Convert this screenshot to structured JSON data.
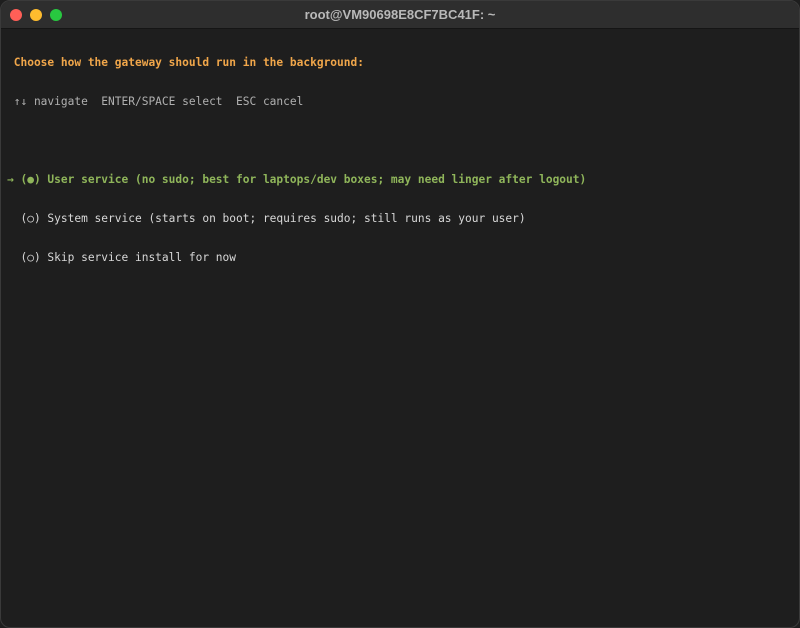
{
  "window": {
    "title": "root@VM90698E8CF7BC41F: ~",
    "controls": [
      "close",
      "minimize",
      "zoom"
    ]
  },
  "terminal": {
    "prompt": " Choose how the gateway should run in the background:",
    "hint": " ↑↓ navigate  ENTER/SPACE select  ESC cancel",
    "options": [
      {
        "text": "→ (●) User service (no sudo; best for laptops/dev boxes; may need linger after logout)",
        "selected": true
      },
      {
        "text": "  (○) System service (starts on boot; requires sudo; still runs as your user)",
        "selected": false
      },
      {
        "text": "  (○) Skip service install for now",
        "selected": false
      }
    ]
  },
  "colors": {
    "background": "#1e1e1e",
    "prompt": "#f0a64a",
    "selected": "#8fb55a",
    "text": "#d8d8d8"
  }
}
